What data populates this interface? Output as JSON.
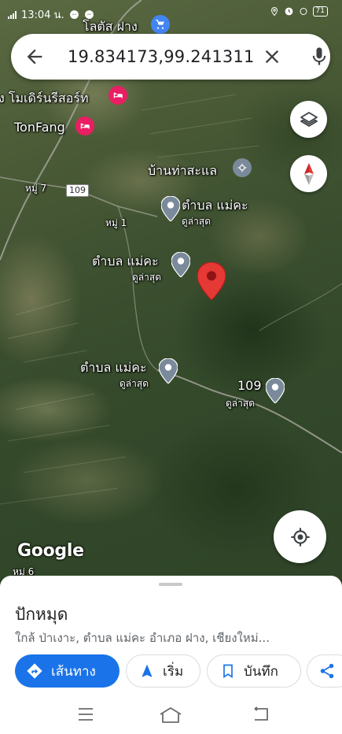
{
  "status_bar": {
    "time": "13:04 น.",
    "battery": "71"
  },
  "search": {
    "query": "19.834173,99.241311"
  },
  "map": {
    "labels": {
      "lotus": "โลตัส ฝาง",
      "resort": "ง โมเดิร์นรีสอร์ท",
      "tonfang": "TonFang",
      "ban_tha": "บ้านท่าสะแล",
      "moo7": "หมู่ 7",
      "route109_badge": "109",
      "moo1": "หมู่ 1",
      "tambon1": "ตำบล แม่คะ",
      "tambon1_sub": "ดูล่าสุด",
      "tambon2": "ตำบล แม่คะ",
      "tambon2_sub": "ดูล่าสุด",
      "tambon3": "ตำบล แม่คะ",
      "tambon3_sub": "ดูล่าสุด",
      "p109": "109",
      "p109_sub": "ดูล่าสุด",
      "moo6": "หมู่ 6"
    },
    "attribution": "Google",
    "colors": {
      "pin_red": "#e53935",
      "poi_blue": "#4285f4",
      "poi_pink": "#e91e63",
      "poi_gray": "#7b8a9a"
    }
  },
  "sheet": {
    "title": "ปักหมุด",
    "address": "ใกล้ ป่าเงาะ, ตำบล แม่คะ อำเภอ ฝาง, เชียงใหม่...",
    "buttons": {
      "directions": "เส้นทาง",
      "start": "เริ่ม",
      "save": "บันทึก"
    },
    "accent": "#1a73e8"
  }
}
